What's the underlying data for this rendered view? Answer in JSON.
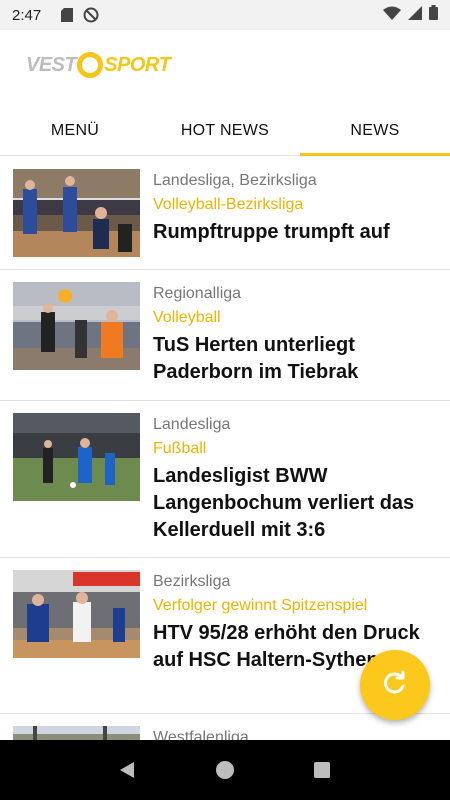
{
  "status": {
    "time": "2:47"
  },
  "brand": {
    "part1": "VEST",
    "part2": "SPORT"
  },
  "tabs": [
    {
      "label": "MENÜ"
    },
    {
      "label": "HOT NEWS"
    },
    {
      "label": "NEWS",
      "active": true
    }
  ],
  "articles": [
    {
      "league": "Landesliga, Bezirksliga",
      "category": "Volleyball-Bezirksliga",
      "headline": "Rumpftruppe trumpft auf"
    },
    {
      "league": "Regionalliga",
      "category": "Volleyball",
      "headline": "TuS Herten unterliegt Paderborn im Tiebrak"
    },
    {
      "league": "Landesliga",
      "category": "Fußball",
      "headline": "Landesligist BWW Langenbochum verliert das Kellerduell mit 3:6"
    },
    {
      "league": "Bezirksliga",
      "category": "Verfolger gewinnt  Spitzenspiel",
      "headline": "HTV 95/28  erhöht den Druck auf HSC Haltern-Sythen II"
    },
    {
      "league": "Westfalenliga",
      "category": "",
      "headline": ""
    }
  ],
  "colors": {
    "accent": "#f5c518",
    "category_text": "#f0b400"
  }
}
